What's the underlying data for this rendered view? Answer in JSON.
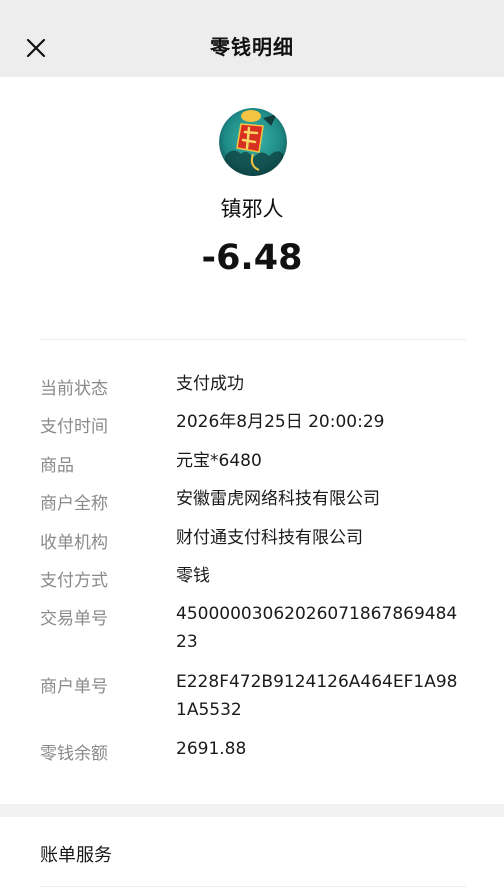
{
  "header": {
    "title": "零钱明细"
  },
  "transaction": {
    "merchant_name": "镇邪人",
    "amount": "-6.48"
  },
  "details": [
    {
      "label": "当前状态",
      "value": "支付成功"
    },
    {
      "label": "支付时间",
      "value": "2026年8月25日 20:00:29"
    },
    {
      "label": "商品",
      "value": "元宝*6480"
    },
    {
      "label": "商户全称",
      "value": "安徽雷虎网络科技有限公司"
    },
    {
      "label": "收单机构",
      "value": "财付通支付科技有限公司"
    },
    {
      "label": "支付方式",
      "value": "零钱"
    },
    {
      "label": "交易单号",
      "value": "4500000306202607186786948423"
    },
    {
      "label": "商户单号",
      "value": "E228F472B9124126A464EF1A981A5532"
    },
    {
      "label": "零钱余额",
      "value": "2691.88"
    }
  ],
  "service": {
    "label": "账单服务"
  },
  "colors": {
    "header_bg": "#ededed",
    "label_gray": "#8a8a8a",
    "avatar_teal": "#1e8a86"
  }
}
